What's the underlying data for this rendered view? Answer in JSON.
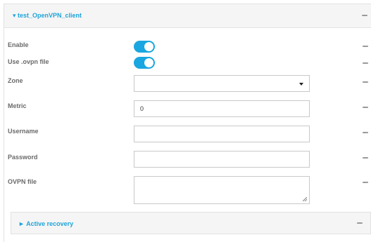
{
  "section": {
    "title": "▾ test_OpenVPN_client"
  },
  "fields": {
    "enable": {
      "label": "Enable",
      "value": true
    },
    "use_ovpn": {
      "label": "Use .ovpn file",
      "value": true
    },
    "zone": {
      "label": "Zone",
      "value": ""
    },
    "metric": {
      "label": "Metric",
      "value": "0"
    },
    "username": {
      "label": "Username",
      "value": ""
    },
    "password": {
      "label": "Password",
      "value": ""
    },
    "ovpn_file": {
      "label": "OVPN file",
      "value": ""
    }
  },
  "subsection": {
    "title": "► Active recovery"
  },
  "colors": {
    "accent": "#1ea4d8",
    "toggle_on": "#1aa6e0"
  }
}
